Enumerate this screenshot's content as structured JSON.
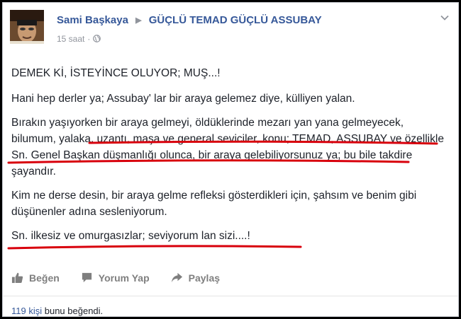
{
  "post": {
    "author": "Sami Başkaya",
    "group": "GÜÇLÜ TEMAD GÜÇLÜ ASSUBAY",
    "time": "15 saat",
    "meta_separator": "·",
    "icons": {
      "privacy": "globe-icon",
      "menu": "chevron-down-icon",
      "arrow": "triangle-right-icon"
    },
    "paragraphs": [
      "DEMEK Kİ, İSTEYİNCE OLUYOR; MUŞ...!",
      "Hani hep derler ya; Assubay' lar bir araya gelemez diye, külliyen yalan.",
      "Bırakın yaşıyorken bir araya gelmeyi, öldüklerinde mezarı yan yana gelmeyecek, bilumum, yalaka, uzantı, maşa ve general seviciler, konu; TEMAD, ASSUBAY ve özellikle Sn. Genel Başkan düşmanlığı olunca, bir araya gelebiliyorsunuz ya; bu bile takdire şayandır.",
      "Kim ne derse desin, bir araya gelme refleksi gösterdikleri için, şahsım ve benim gibi düşünenler adına sesleniyorum.",
      "Sn. ilkesiz ve omurgasızlar; seviyorum lan sizi....!"
    ]
  },
  "actions": {
    "like": "Beğen",
    "comment": "Yorum Yap",
    "share": "Paylaş"
  },
  "likes": {
    "count_link": "119 kişi",
    "suffix": " bunu beğendi."
  },
  "colors": {
    "link": "#365899",
    "text": "#1d2129",
    "muted": "#90949c",
    "underline": "#d8000c"
  }
}
